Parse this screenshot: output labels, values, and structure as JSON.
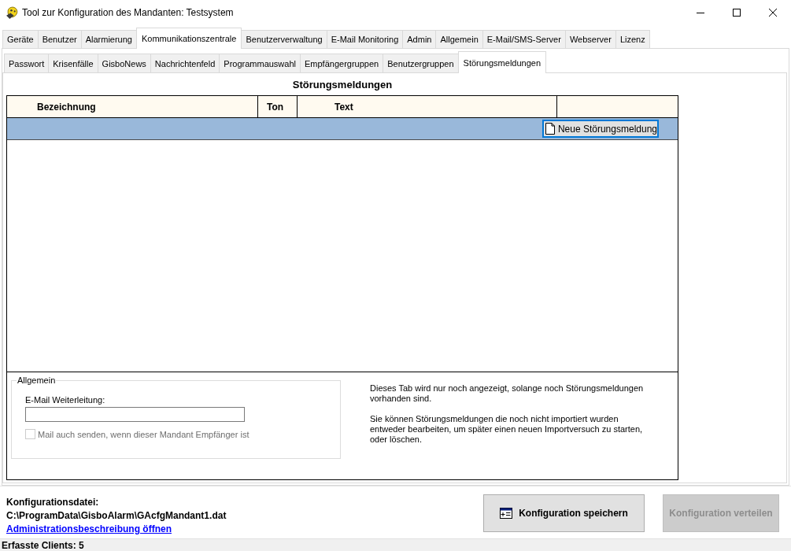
{
  "window": {
    "title": "Tool zur Konfiguration des Mandanten: Testsystem"
  },
  "main_tabs": [
    {
      "label": "Geräte",
      "selected": false
    },
    {
      "label": "Benutzer",
      "selected": false
    },
    {
      "label": "Alarmierung",
      "selected": false
    },
    {
      "label": "Kommunikationszentrale",
      "selected": true
    },
    {
      "label": "Benutzerverwaltung",
      "selected": false
    },
    {
      "label": "E-Mail Monitoring",
      "selected": false
    },
    {
      "label": "Admin",
      "selected": false
    },
    {
      "label": "Allgemein",
      "selected": false
    },
    {
      "label": "E-Mail/SMS-Server",
      "selected": false
    },
    {
      "label": "Webserver",
      "selected": false
    },
    {
      "label": "Lizenz",
      "selected": false
    }
  ],
  "sub_tabs": [
    {
      "label": "Passwort",
      "selected": false
    },
    {
      "label": "Krisenfälle",
      "selected": false
    },
    {
      "label": "GisboNews",
      "selected": false
    },
    {
      "label": "Nachrichtenfeld",
      "selected": false
    },
    {
      "label": "Programmauswahl",
      "selected": false
    },
    {
      "label": "Empfängergruppen",
      "selected": false
    },
    {
      "label": "Benutzergruppen",
      "selected": false
    },
    {
      "label": "Störungsmeldungen",
      "selected": true
    }
  ],
  "panel": {
    "title": "Störungsmeldungen",
    "table": {
      "columns": [
        "Bezeichnung",
        "Ton",
        "Text"
      ],
      "new_button": "Neue Störungsmeldung"
    },
    "general_group": {
      "title": "Allgemein",
      "email_label": "E-Mail Weiterleitung:",
      "checkbox": {
        "label": "Mail auch senden, wenn dieser Mandant Empfänger ist",
        "checked": false,
        "disabled": true
      }
    },
    "info_text": [
      "Dieses Tab wird nur noch angezeigt, solange noch Störungsmeldungen vorhanden sind.",
      "Sie können Störungsmeldungen die noch nicht importiert wurden entweder bearbeiten, um später einen neuen Importversuch zu starten, oder löschen."
    ]
  },
  "footer": {
    "config_label": "Konfigurationsdatei:",
    "config_path": "C:\\ProgramData\\GisboAlarm\\GAcfgMandant1.dat",
    "link": "Administrationsbeschreibung öffnen",
    "save_button": {
      "label": "Konfiguration speichern",
      "disabled": false
    },
    "distribute_button": {
      "label": "Konfiguration verteilen",
      "disabled": true
    }
  },
  "status_bar": {
    "text": "Erfasste Clients: 5"
  }
}
